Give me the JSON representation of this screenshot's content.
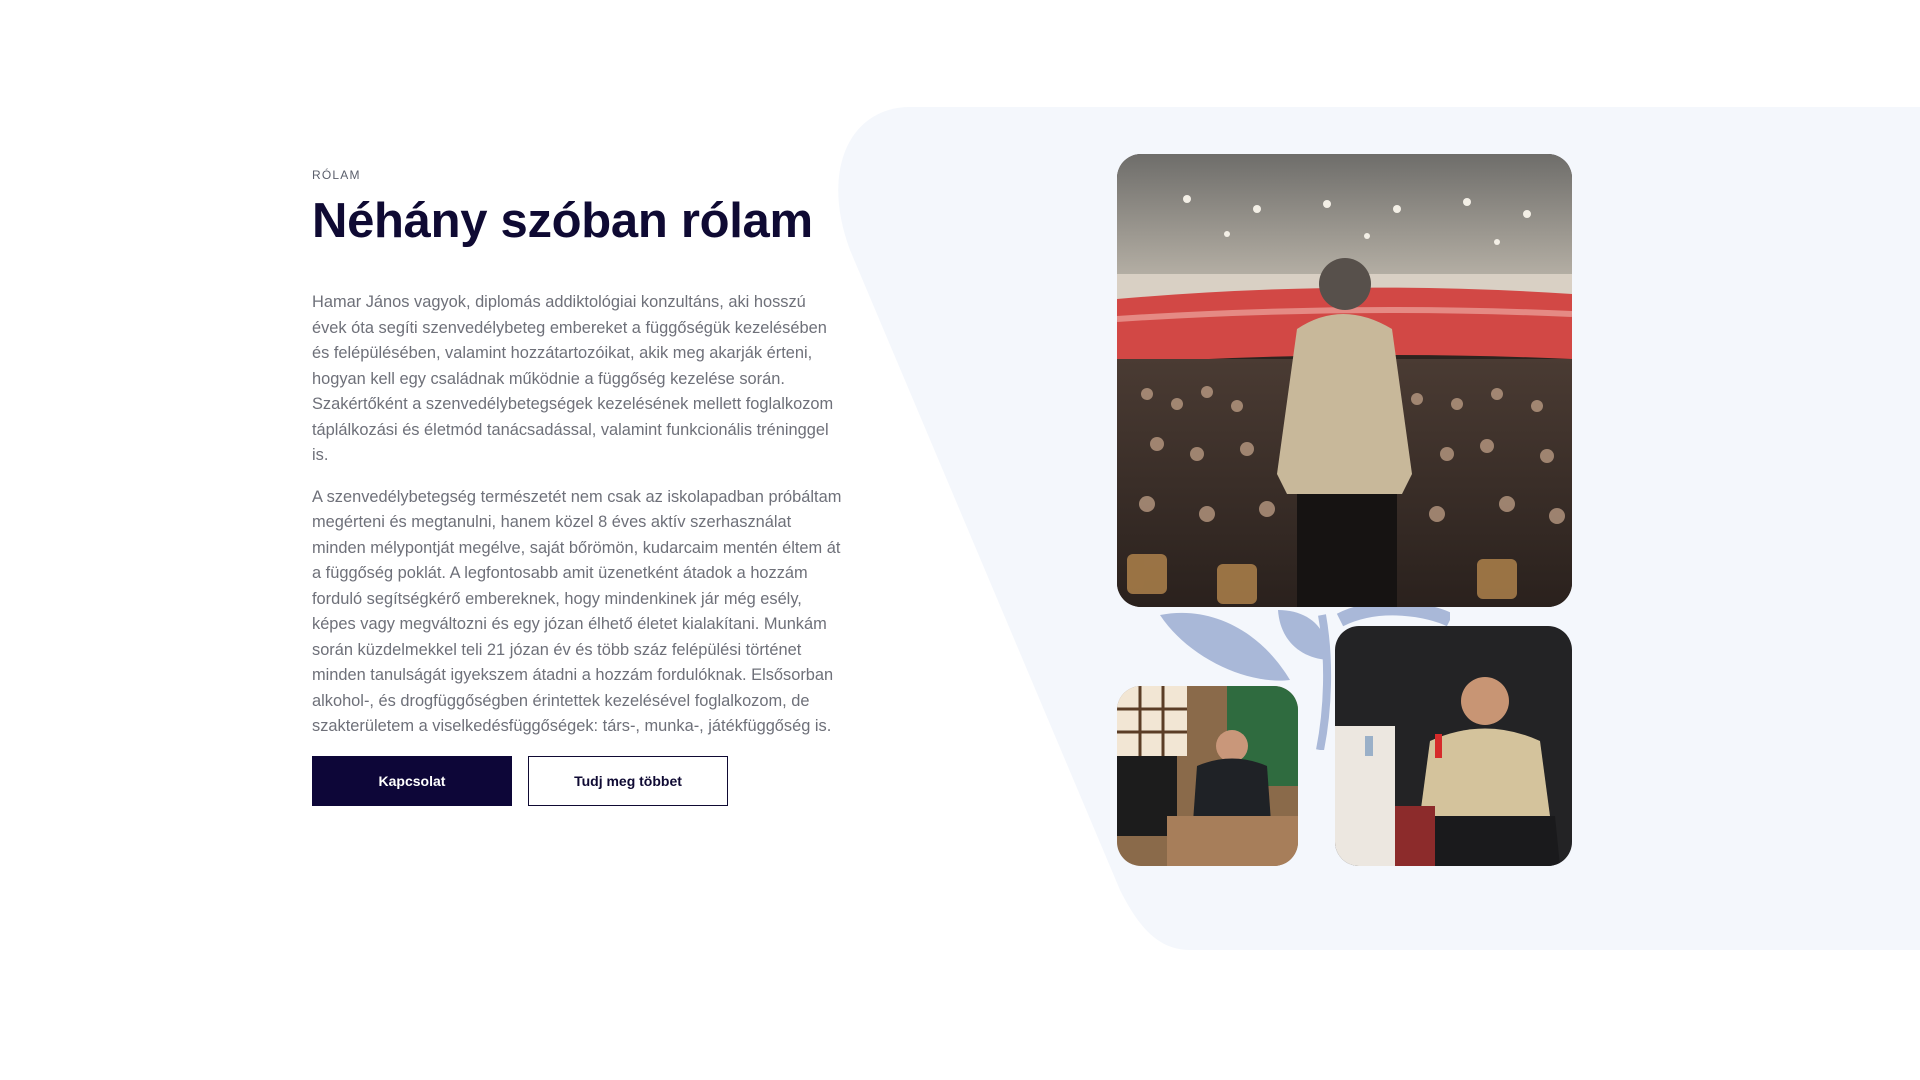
{
  "about": {
    "eyebrow": "RÓLAM",
    "title": "Néhány szóban rólam",
    "paragraph_1": "Hamar János vagyok, diplomás addiktológiai konzultáns, aki hosszú évek óta segíti szenvedélybeteg embereket a függőségük kezelésében és felépülésében, valamint hozzátartozóikat, akik meg akarják érteni, hogyan kell egy családnak működnie a függőség kezelése során. Szakértőként a szenvedélybetegségek kezelésének mellett foglalkozom táplálkozási és életmód tanácsadással, valamint funkcionális tréninggel is.",
    "paragraph_2": "A szenvedélybetegség természetét nem csak az iskolapadban próbáltam megérteni és megtanulni, hanem közel 8 éves aktív szerhasználat minden mélypontját megélve, saját bőrömön, kudarcaim mentén éltem át a függőség poklát. A legfontosabb amit üzenetként átadok a hozzám forduló segítségkérő embereknek, hogy mindenkinek jár még esély, képes vagy megváltozni és egy józan élhető életet kialakítani. Munkám során küzdelmekkel teli 21 józan év és több száz felépülési történet minden tanulságát igyekszem átadni a hozzám fordulóknak. Elsősorban alkohol-, és drogfüggőségben érintettek kezelésével foglalkozom, de szakterületem a viselkedésfüggőségek: társ-, munka-, játékfüggőség is.",
    "primary_button": "Kapcsolat",
    "secondary_button": "Tudj meg többet"
  },
  "colors": {
    "heading": "#0f0a33",
    "body_text": "#6e7079",
    "primary_button_bg": "#0d0638",
    "background_shape": "#f4f7fc",
    "leaf": "#a9b8d8"
  },
  "images": {
    "main": "speaker-on-stage-audience-photo",
    "small": "man-seated-at-table-photo",
    "medium": "man-with-microphone-photo"
  }
}
